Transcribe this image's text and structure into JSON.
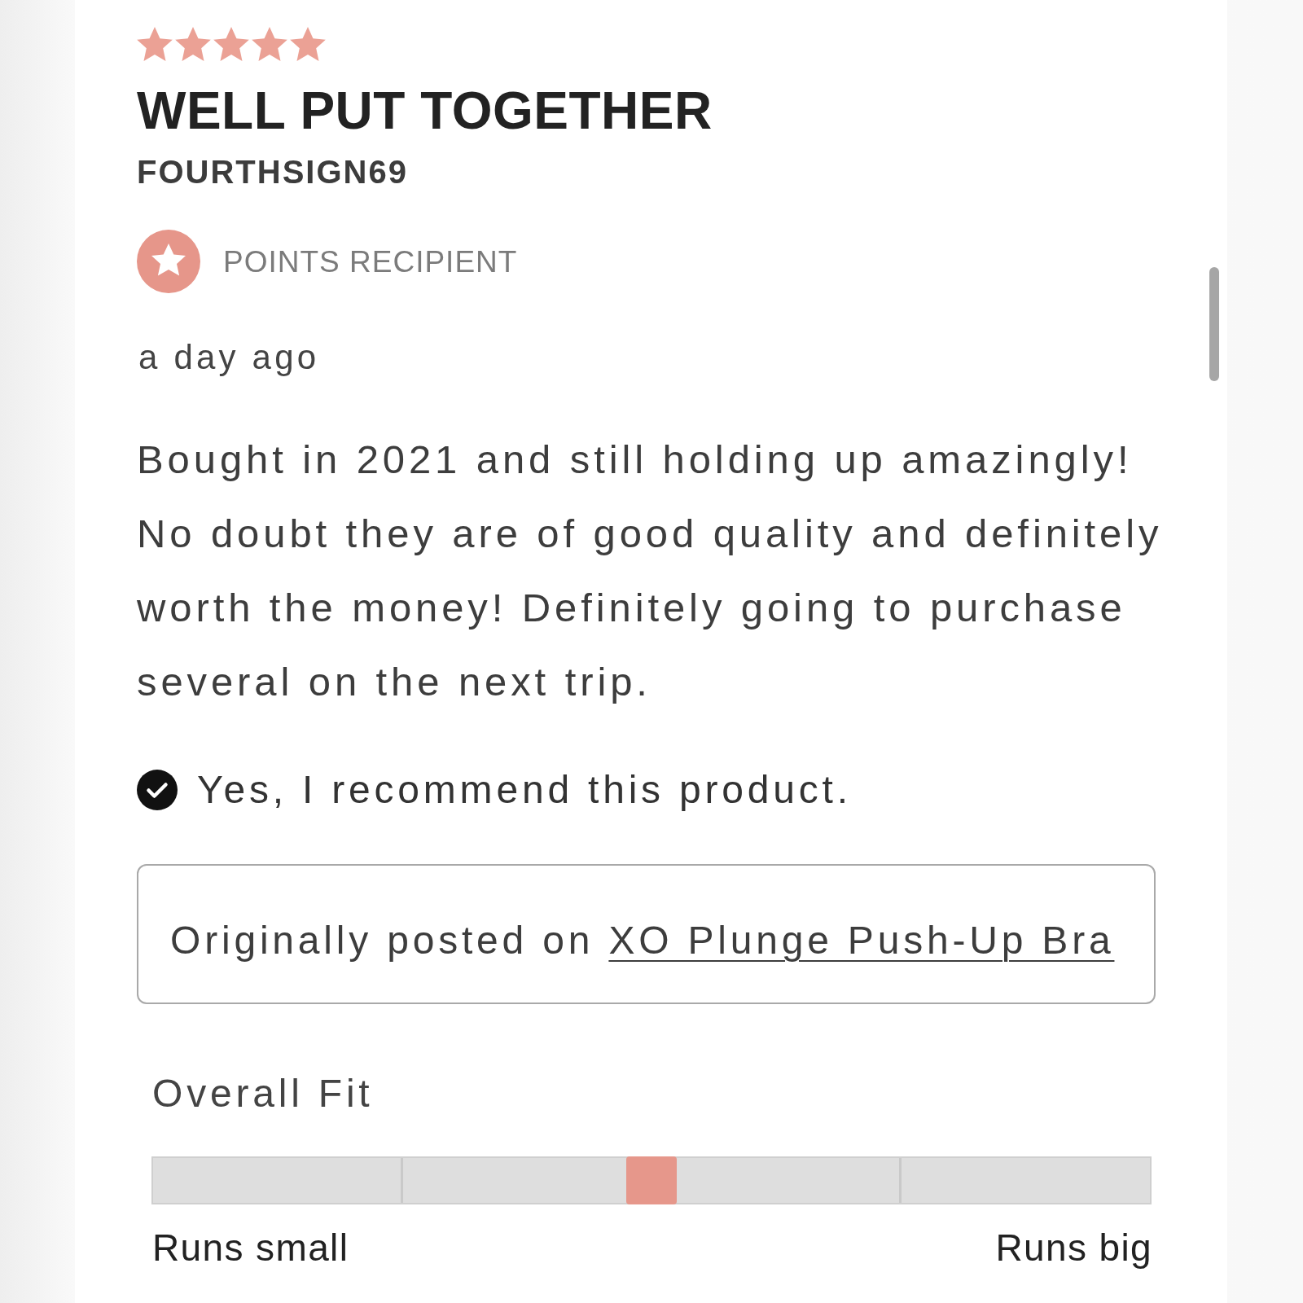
{
  "review": {
    "stars": 5,
    "title": "WELL PUT TOGETHER",
    "author": "FOURTHSIGN69",
    "badge": {
      "label": "POINTS RECIPIENT"
    },
    "date": "a day ago",
    "body": "Bought in 2021 and still holding up amazingly! No doubt they are of good quality and definitely worth the money! Definitely going to purchase several on the next trip.",
    "recommendation": {
      "checked": true,
      "text": "Yes, I recommend this product."
    },
    "origin": {
      "prefix": "Originally posted on",
      "link": "XO Plunge Push-Up Bra"
    },
    "overall_fit": {
      "label": "Overall Fit",
      "level": 0.5,
      "min_label": "Runs small",
      "max_label": "Runs big"
    }
  }
}
